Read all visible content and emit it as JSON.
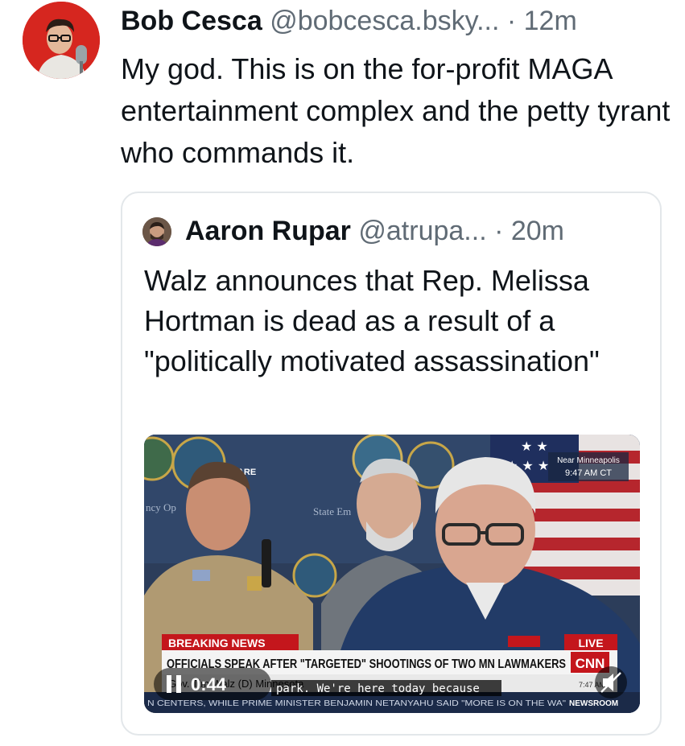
{
  "post": {
    "author_name": "Bob Cesca",
    "handle": "@bobcesca.bsky...",
    "separator": " · ",
    "time": "12m",
    "text": "My god. This is on the for-profit MAGA entertainment complex and the petty tyrant who commands it."
  },
  "quote": {
    "author_name": "Aaron Rupar",
    "handle": "@atrupa...",
    "separator": " · ",
    "time": "20m",
    "text": "Walz announces that Rep. Melissa Hortman is dead as a result of a \"politically motivated assassination\""
  },
  "video": {
    "station_bug": "KARE",
    "wall_text": "State Em",
    "wall_text_left": "ncy Op",
    "location": "Near Minneapolis",
    "clock": "9:47 AM CT",
    "breaking_label": "BREAKING NEWS",
    "live_label": "LIVE",
    "headline": "OFFICIALS SPEAK AFTER \"TARGETED\" SHOOTINGS OF TWO MN LAWMAKERS",
    "network": "CNN",
    "chyron_small_time": "7:47 AM",
    "speaker_line": "Gov. Tim Walz (D) Minnesota",
    "caption": "park. We're here today because",
    "ticker": "N CENTERS, WHILE PRIME MINISTER BENJAMIN NETANYAHU SAID \"MORE IS ON THE WA\"",
    "ticker_brand": "NEWSROOM",
    "elapsed": "0:44",
    "controls": {
      "pause_icon": "pause-icon",
      "mute_icon": "speaker-muted-icon"
    },
    "colors": {
      "breaking_red": "#c4161c",
      "live_red": "#c4161c",
      "chyron_white": "#f4f4f4",
      "navy": "#1b2a48"
    }
  }
}
